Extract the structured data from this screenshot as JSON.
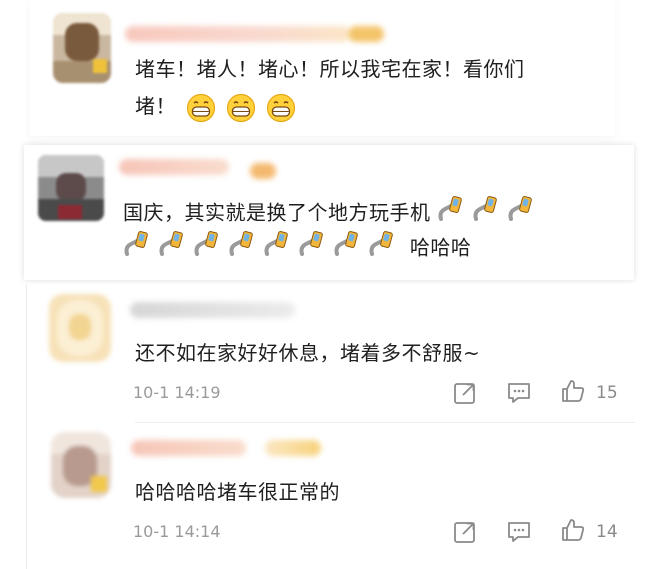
{
  "comments": [
    {
      "text_line1": "堵车！堵人！堵心！所以我宅在家！看你们",
      "text_line2": "堵！"
    },
    {
      "text_line1": "国庆，其实就是换了个地方玩手机",
      "text_line2_suffix": "哈哈哈"
    }
  ],
  "replies": [
    {
      "text": "还不如在家好好休息，堵着多不舒服~",
      "time": "10-1 14:19",
      "likes": "15"
    },
    {
      "text": "哈哈哈哈堵车很正常的",
      "time": "10-1 14:14",
      "likes": "14"
    }
  ],
  "icons": {
    "share": "share-icon",
    "comment": "comment-icon",
    "like": "thumbs-up-icon",
    "grin": "grinning-emoji-icon",
    "phone": "phone-emoji-icon"
  }
}
